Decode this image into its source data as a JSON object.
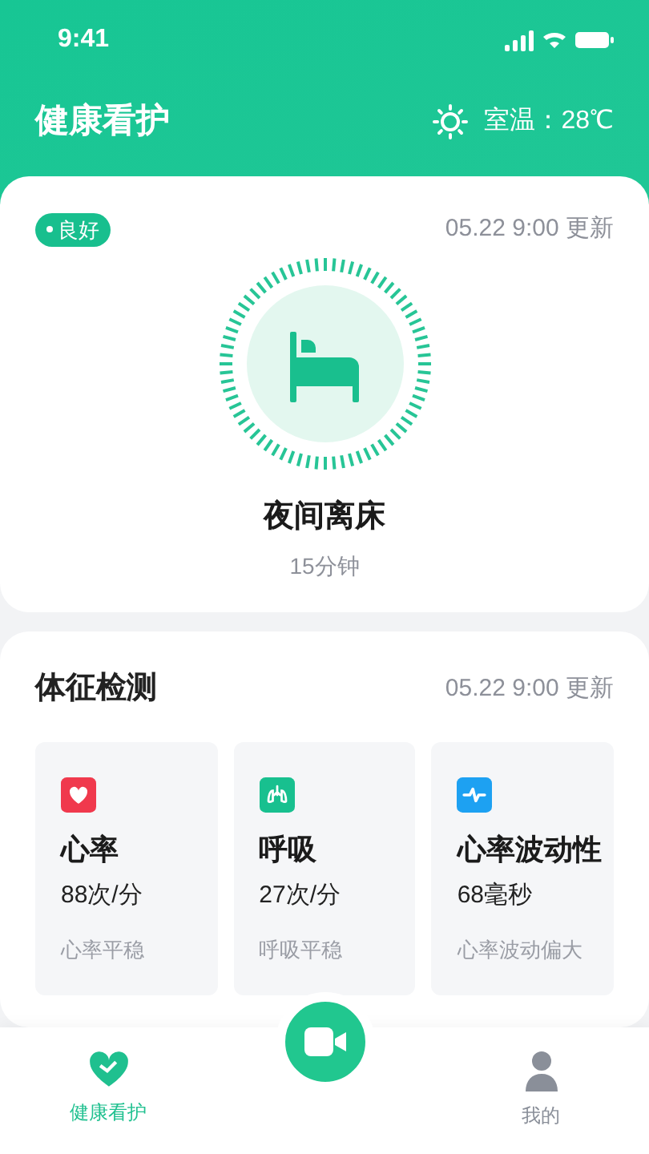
{
  "status_bar": {
    "time": "9:41"
  },
  "header": {
    "title": "健康看护",
    "weather": "室温：28℃"
  },
  "status_card": {
    "badge": "良好",
    "updated": "05.22 9:00 更新",
    "event": "夜间离床",
    "duration": "15分钟"
  },
  "vitals": {
    "title": "体征检测",
    "updated": "05.22 9:00 更新",
    "items": [
      {
        "kind": "heart",
        "color": "#f0394d",
        "name": "心率",
        "value": "88次/分",
        "note": "心率平稳"
      },
      {
        "kind": "lungs",
        "color": "#18c08f",
        "name": "呼吸",
        "value": "27次/分",
        "note": "呼吸平稳"
      },
      {
        "kind": "pulse",
        "color": "#1da1f2",
        "name": "心率波动性",
        "value": "68毫秒",
        "note": "心率波动偏大"
      }
    ]
  },
  "tab_bar": [
    {
      "kind": "heart",
      "label": "健康看护",
      "selected": true
    },
    {
      "kind": "camera",
      "selected": false
    },
    {
      "kind": "person",
      "label": "我的",
      "selected": false
    }
  ]
}
